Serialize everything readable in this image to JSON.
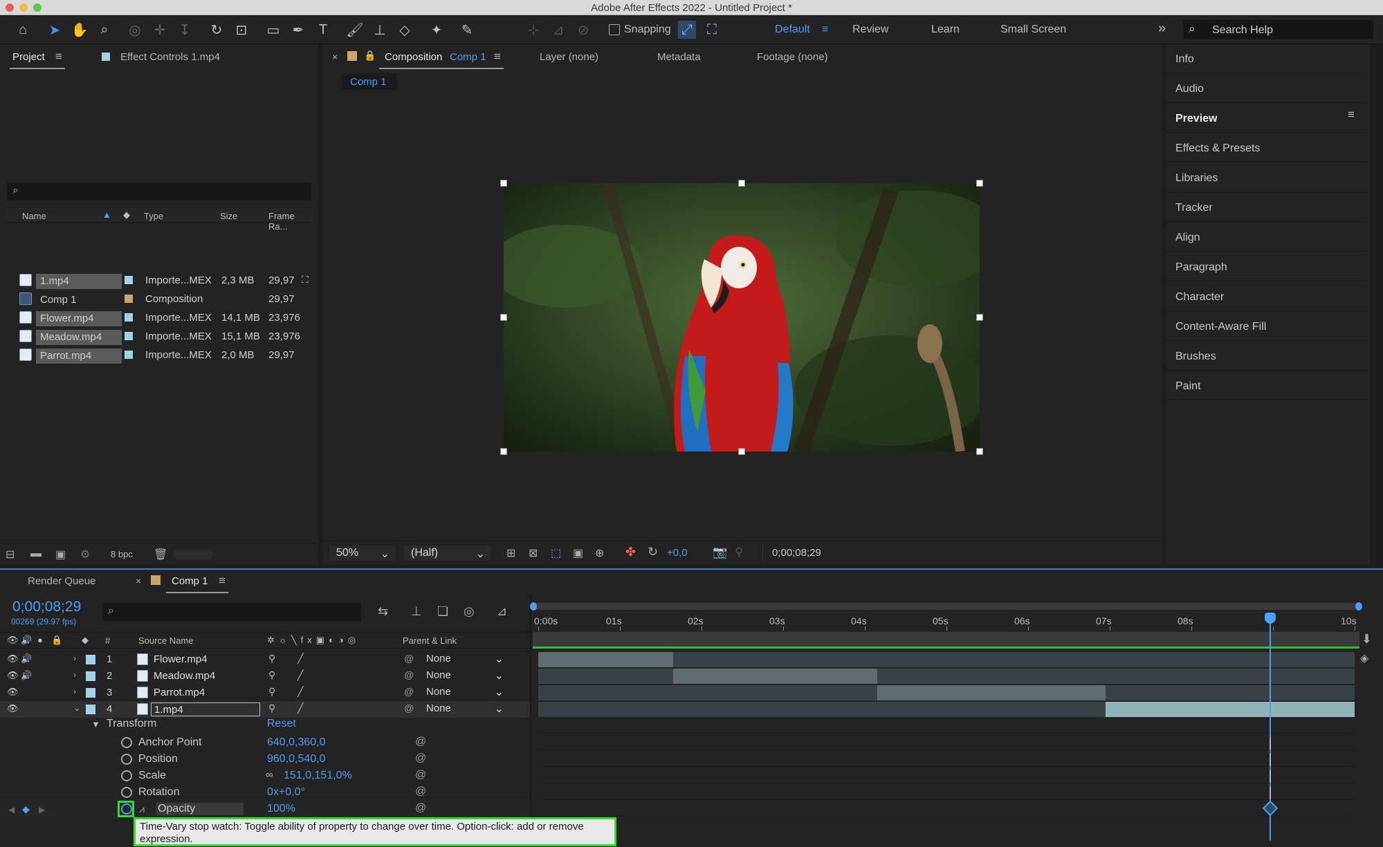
{
  "window": {
    "title": "Adobe After Effects 2022 - Untitled Project *"
  },
  "toolbar": {
    "snapping_label": "Snapping",
    "workspaces": [
      "Default",
      "Review",
      "Learn",
      "Small Screen"
    ],
    "overflow_label": "»",
    "search_placeholder": "Search Help"
  },
  "project_panel": {
    "tab_project": "Project",
    "tab_effect_controls": "Effect Controls 1.mp4",
    "columns": [
      "Name",
      "Type",
      "Size",
      "Frame Ra..."
    ],
    "items": [
      {
        "name": "1.mp4",
        "type": "Importe...MEX",
        "size": "2,3 MB",
        "fps": "29,97",
        "selected": true,
        "label_color": "#9fd3e6"
      },
      {
        "name": "Comp 1",
        "type": "Composition",
        "size": "",
        "fps": "29,97",
        "selected": false,
        "label_color": "#c9a66b"
      },
      {
        "name": "Flower.mp4",
        "type": "Importe...MEX",
        "size": "14,1 MB",
        "fps": "23,976",
        "selected": true,
        "label_color": "#9fd3e6"
      },
      {
        "name": "Meadow.mp4",
        "type": "Importe...MEX",
        "size": "15,1 MB",
        "fps": "23,976",
        "selected": true,
        "label_color": "#9fd3e6"
      },
      {
        "name": "Parrot.mp4",
        "type": "Importe...MEX",
        "size": "2,0 MB",
        "fps": "29,97",
        "selected": true,
        "label_color": "#9fd3e6"
      }
    ],
    "bpc_label": "8 bpc"
  },
  "viewer": {
    "tab_composition": "Composition",
    "tab_composition_name": "Comp 1",
    "tab_layer": "Layer (none)",
    "tab_metadata": "Metadata",
    "tab_footage": "Footage (none)",
    "comp_chip": "Comp 1",
    "zoom": "50%",
    "resolution": "(Half)",
    "exposure": "+0,0",
    "timecode": "0;00;08;29"
  },
  "right_panel": {
    "items": [
      "Info",
      "Audio",
      "Preview",
      "Effects & Presets",
      "Libraries",
      "Tracker",
      "Align",
      "Paragraph",
      "Character",
      "Content-Aware Fill",
      "Brushes",
      "Paint"
    ],
    "active": "Preview"
  },
  "timeline": {
    "tab_render_queue": "Render Queue",
    "tab_comp": "Comp 1",
    "timecode": "0;00;08;29",
    "frame_info": "00269 (29.97 fps)",
    "col_hash": "#",
    "col_source": "Source Name",
    "col_parent": "Parent & Link",
    "ruler_ticks": [
      "0:00s",
      "01s",
      "02s",
      "03s",
      "04s",
      "05s",
      "06s",
      "07s",
      "08s",
      "",
      "10s"
    ],
    "playhead_seconds": 8.97,
    "duration_seconds": 10,
    "layers": [
      {
        "num": "1",
        "name": "Flower.mp4",
        "parent": "None",
        "audio": true,
        "in": 0,
        "out": 1.65
      },
      {
        "num": "2",
        "name": "Meadow.mp4",
        "parent": "None",
        "audio": true,
        "in": 1.65,
        "out": 4.15
      },
      {
        "num": "3",
        "name": "Parrot.mp4",
        "parent": "None",
        "audio": false,
        "in": 4.15,
        "out": 6.95
      },
      {
        "num": "4",
        "name": "1.mp4",
        "parent": "None",
        "audio": false,
        "in": 6.95,
        "out": 10,
        "selected": true
      }
    ],
    "transform_label": "Transform",
    "reset_label": "Reset",
    "properties": [
      {
        "name": "Anchor Point",
        "value": "640,0,360,0"
      },
      {
        "name": "Position",
        "value": "960,0,540,0"
      },
      {
        "name": "Scale",
        "value": "151,0,151,0%"
      },
      {
        "name": "Rotation",
        "value": "0x+0,0°"
      },
      {
        "name": "Opacity",
        "value": "100%"
      }
    ],
    "tooltip": "Time-Vary stop watch: Toggle ability of property to change over time. Option-click: add or remove expression."
  }
}
